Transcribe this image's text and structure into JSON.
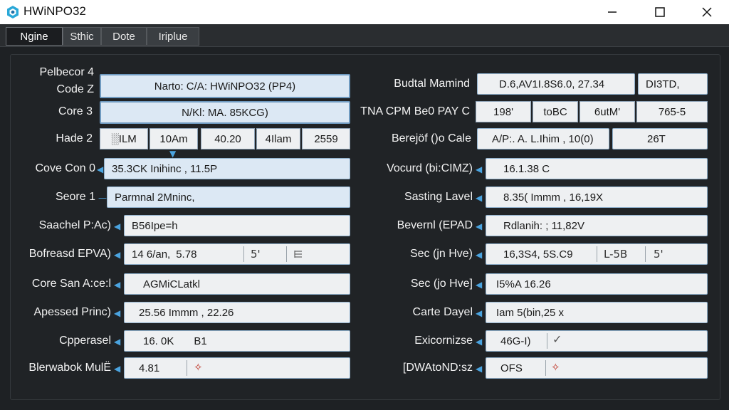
{
  "window": {
    "title": "HWiNPO32"
  },
  "tabs": [
    {
      "label": "Ngine",
      "active": true
    },
    {
      "label": "Sthic"
    },
    {
      "label": "Dote"
    },
    {
      "label": "Iriplue"
    }
  ],
  "left": {
    "label_r1a": "Pelbecor 4",
    "label_r1b": "Code Z",
    "field_r1": "Narto: C/A: HWiNPO32 (PP4)",
    "label_r2": "Core 3",
    "field_r2": "N/Kl: MA. 85KCG)",
    "label_r3": "Hade 2",
    "cells_r3": [
      "░ILM",
      "10Am",
      "40.20",
      "4Ilam",
      "2559"
    ],
    "label_r4": "Cove Con 0",
    "field_r4": "35.3CK Inihinc , 11.5P",
    "label_r5": "Seore 1",
    "field_r5": "Parmnal 2Mninc,",
    "label_r6": "Saachel P:Ac)",
    "field_r6": "B56Ipe=h",
    "label_r7": "Bofreasd EPVA)",
    "field_r7a": "14 6/an, ",
    "field_r7b": "5.78",
    "field_r7c": "5'",
    "label_r8": "Core San A:ce:l",
    "field_r8": "AGMiCLatkl",
    "label_r9": "Apessed Princ)",
    "field_r9": "25.56 Immm , 22.26",
    "label_r10": "Cpperasel",
    "field_r10a": "16. 0K",
    "field_r10b": "B1",
    "label_r11": "Blerwabok MulË",
    "field_r11": "4.81"
  },
  "right": {
    "label_r1": "Budtal Mamind",
    "field_r1a": "D.6,AV1I.8S6.0, 27.34",
    "field_r1b": "DI3TD,",
    "label_r2": "TNA CPM Be0 PAY C",
    "cells_r2": [
      "198'",
      "toBC",
      "6utM'",
      "765-5"
    ],
    "label_r3": "Berejöf ()o Cale",
    "field_r3a": "A/P:. A. L.Ihim , 10(0)",
    "field_r3b": "26T",
    "label_r4": "Vocurd (bi:CIMZ)",
    "field_r4": "16.1.38 C",
    "label_r5": "Sasting Lavel",
    "field_r5": "8.35( Immm , 16,19X",
    "label_r6": "Bevernl (EPAD",
    "field_r6": "Rdlanih: ; 11,82V",
    "label_r7": "Sec (jn Hve)",
    "field_r7a": "16,3S4, 5S.C9",
    "field_r7b": "L-5B",
    "field_r7c": "5'",
    "label_r8": "Sec (jo Hve]",
    "field_r8": "I5%A 16.26",
    "label_r9": "Carte Dayel",
    "field_r9": "Iam 5(bin,25 x",
    "label_r10": "Exicornizse",
    "field_r10a": "46G-I)",
    "label_r11": "[DWAtoND:sz",
    "field_r11": "OFS"
  },
  "colors": {
    "accent": "#4aa3df",
    "alert": "#c0392b"
  }
}
